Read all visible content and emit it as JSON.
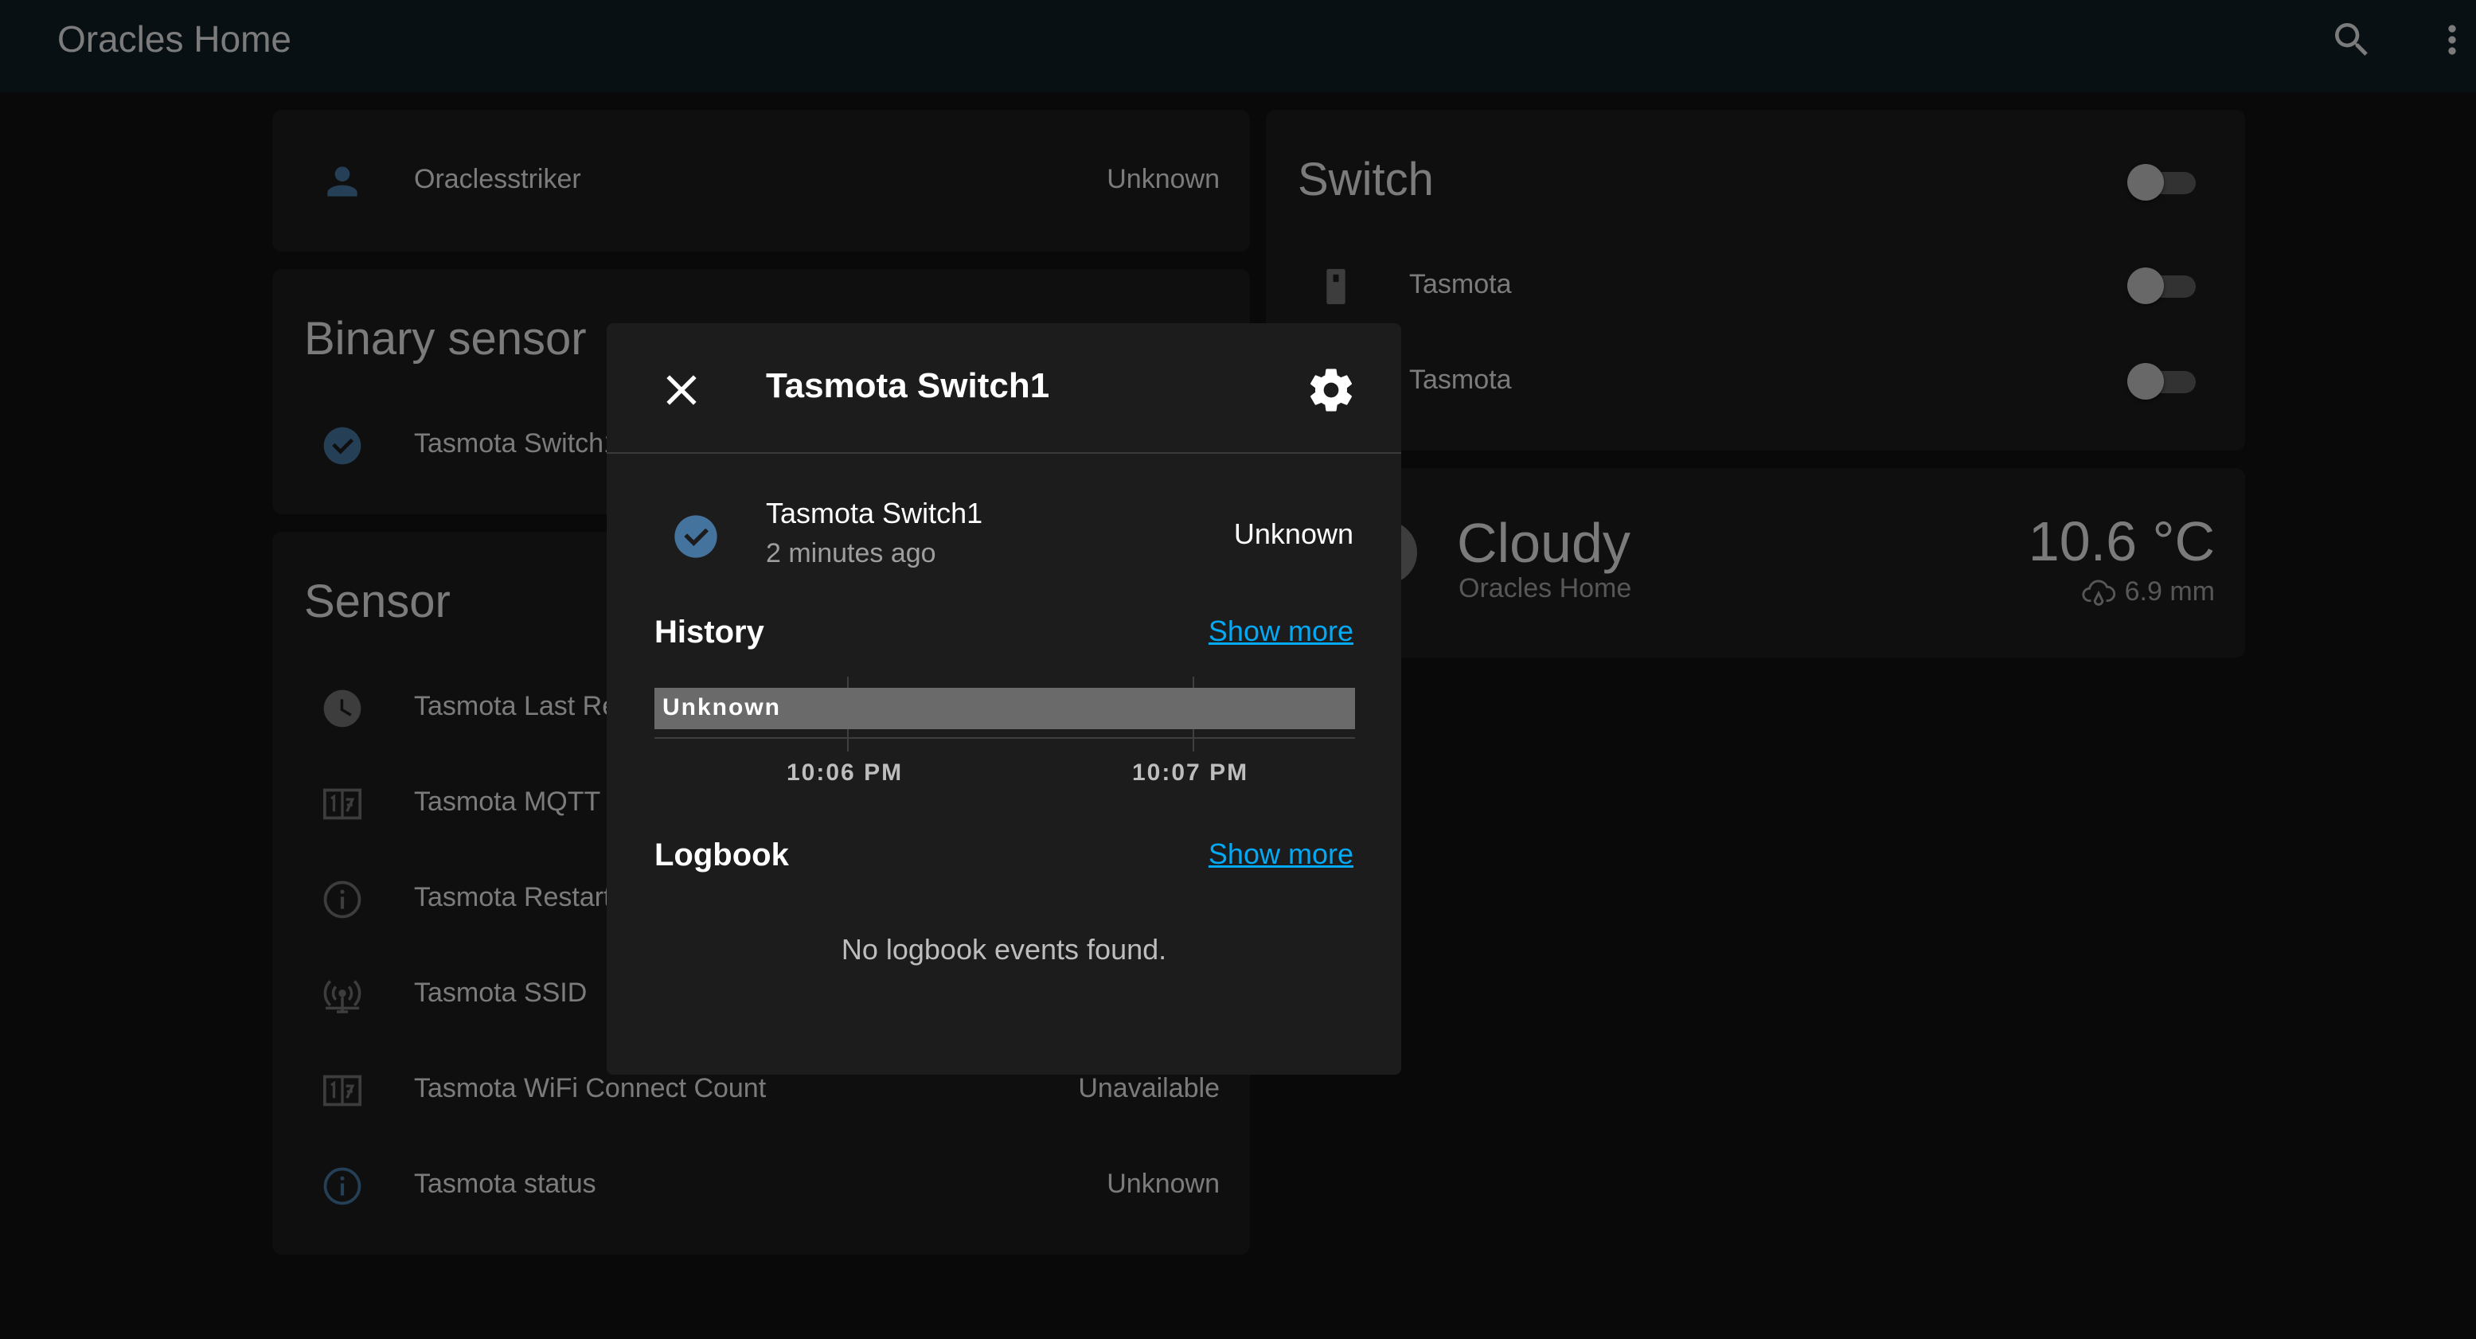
{
  "header": {
    "title": "Oracles Home",
    "search_icon": "search-icon",
    "menu_icon": "dots-vertical-icon"
  },
  "person_card": {
    "name": "Oraclesstriker",
    "state": "Unknown",
    "icon": "account-icon",
    "icon_color": "#44739e"
  },
  "binary_sensor": {
    "title": "Binary sensor",
    "items": [
      {
        "name": "Tasmota Switch1",
        "icon": "check-circle-icon"
      }
    ]
  },
  "sensor": {
    "title": "Sensor",
    "items": [
      {
        "name": "Tasmota Last Restart Time",
        "state": "",
        "icon": "clock-icon"
      },
      {
        "name": "Tasmota MQTT Connect Count",
        "state": "",
        "icon": "counter-icon"
      },
      {
        "name": "Tasmota Restart Reason",
        "state": "",
        "icon": "information-icon"
      },
      {
        "name": "Tasmota SSID",
        "state": "",
        "icon": "access-point-icon"
      },
      {
        "name": "Tasmota WiFi Connect Count",
        "state": "Unavailable",
        "icon": "counter-icon"
      },
      {
        "name": "Tasmota status",
        "state": "Unknown",
        "icon": "information-icon"
      }
    ]
  },
  "switch_card": {
    "title": "Switch",
    "items": [
      {
        "name": "Tasmota",
        "icon": "light-switch-icon"
      },
      {
        "name": "Tasmota",
        "icon": "light-switch-icon"
      }
    ]
  },
  "weather": {
    "condition": "Cloudy",
    "location": "Oracles Home",
    "temperature": "10.6 °C",
    "precipitation": "6.9 mm"
  },
  "dialog": {
    "title": "Tasmota Switch1",
    "entity_name": "Tasmota Switch1",
    "last_changed": "2 minutes ago",
    "state": "Unknown",
    "history_title": "History",
    "history_show_more": "Show more",
    "timeline_state": "Unknown",
    "timeline_ticks": [
      "10:06 PM",
      "10:07 PM"
    ],
    "logbook_title": "Logbook",
    "logbook_show_more": "Show more",
    "logbook_empty": "No logbook events found."
  },
  "colors": {
    "accent_blue": "#44739e",
    "link": "#03a9f4",
    "header_bg": "#101e24",
    "card_bg": "#1c1c1c"
  }
}
